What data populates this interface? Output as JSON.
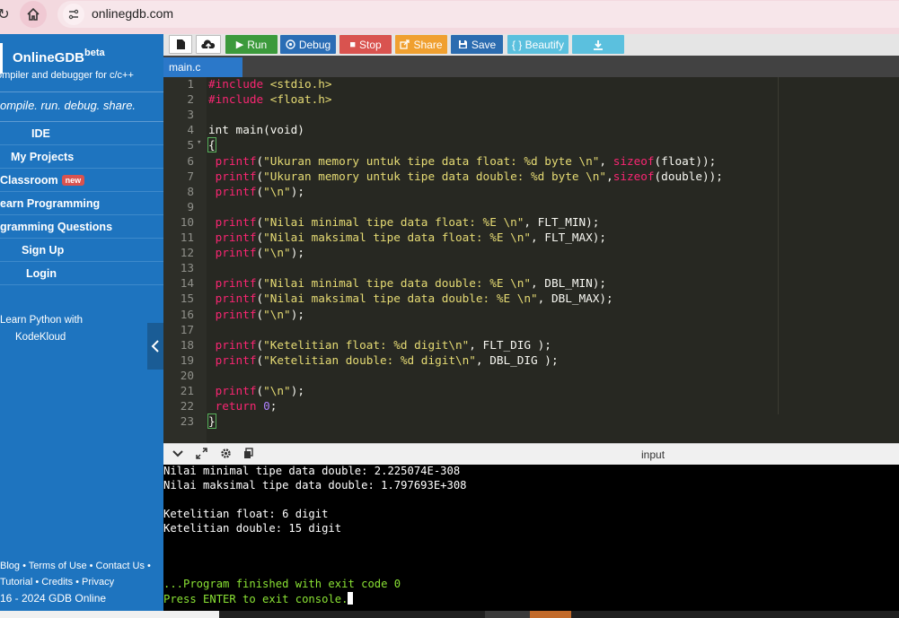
{
  "browser": {
    "url": "onlinegdb.com"
  },
  "sidebar": {
    "brand": "OnlineGDB",
    "beta": "beta",
    "subtitle": "ompiler and debugger for c/c++",
    "tagline": "ompile. run. debug. share.",
    "nav": [
      {
        "label": "IDE",
        "indent": 35
      },
      {
        "label": "My Projects",
        "indent": 12
      },
      {
        "label": "Classroom",
        "indent": 0,
        "badge": "new"
      },
      {
        "label": "earn Programming",
        "indent": 0
      },
      {
        "label": "gramming Questions",
        "indent": 0
      },
      {
        "label": "Sign Up",
        "indent": 24
      },
      {
        "label": "Login",
        "indent": 29
      }
    ],
    "promo_line1": "Learn Python with",
    "promo_line2": "KodeKloud",
    "footer_line1": "Blog • Terms of Use • Contact Us •",
    "footer_line2": "Tutorial • Credits • Privacy",
    "footer_line3": "16 - 2024 GDB Online"
  },
  "toolbar": {
    "run": "Run",
    "debug": "Debug",
    "stop": "Stop",
    "share": "Share",
    "save": "Save",
    "beautify": "{ } Beautify"
  },
  "tabs": {
    "active": "main.c"
  },
  "editor": {
    "lines": [
      "1",
      "2",
      "3",
      "4",
      "5",
      "6",
      "7",
      "8",
      "9",
      "10",
      "11",
      "12",
      "13",
      "14",
      "15",
      "16",
      "17",
      "18",
      "19",
      "20",
      "21",
      "22",
      "23"
    ]
  },
  "console": {
    "input_label": "input",
    "output": [
      "Nilai minimal tipe data double: 2.225074E-308",
      "Nilai maksimal tipe data double: 1.797693E+308",
      "",
      "Ketelitian float: 6 digit",
      "Ketelitian double: 15 digit"
    ],
    "finished": "...Program finished with exit code 0",
    "press_enter": "Press ENTER to exit console."
  },
  "colors": {
    "sidebar": "#1e74bf",
    "run": "#3c9a3c",
    "debug": "#2a6db5",
    "stop": "#d9534f",
    "share": "#f0a030",
    "save": "#2b6cb0",
    "beautify": "#5bc0de",
    "download": "#5bc0de"
  }
}
